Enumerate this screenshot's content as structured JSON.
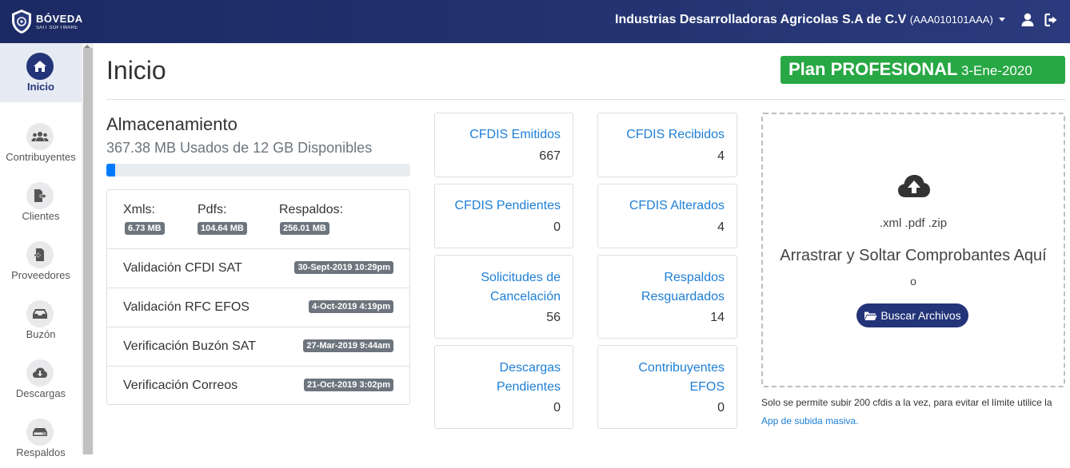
{
  "navbar": {
    "brand_name": "BÓVEDA",
    "brand_sub": "SAIT SOFTWARE",
    "company_name": "Industrias Desarrolladoras Agricolas S.A de C.V",
    "company_rfc": "(AAA010101AAA)",
    "icons": [
      "user-icon",
      "logout-icon",
      "caret-down-icon"
    ]
  },
  "sidebar": {
    "items": [
      {
        "label": "Inicio",
        "icon": "home-icon",
        "active": true
      },
      {
        "label": "Contribuyentes",
        "icon": "users-icon"
      },
      {
        "label": "Clientes",
        "icon": "file-export-icon"
      },
      {
        "label": "Proveedores",
        "icon": "file-import-icon"
      },
      {
        "label": "Buzón",
        "icon": "inbox-icon"
      },
      {
        "label": "Descargas",
        "icon": "download-icon"
      },
      {
        "label": "Respaldos",
        "icon": "hdd-icon"
      }
    ]
  },
  "header": {
    "title": "Inicio",
    "plan": "Plan PROFESIONAL",
    "plan_date": "3-Ene-2020"
  },
  "storage": {
    "title": "Almacenamiento",
    "subtitle": "367.38 MB Usados de 12 GB Disponibles",
    "used_fraction": 0.03,
    "stats": [
      {
        "label": "Xmls:",
        "value": "6.73 MB"
      },
      {
        "label": "Pdfs:",
        "value": "104.64 MB"
      },
      {
        "label": "Respaldos:",
        "value": "256.01 MB"
      }
    ],
    "rows": [
      {
        "label": "Validación CFDI SAT",
        "date": "30-Sept-2019 10:29pm"
      },
      {
        "label": "Validación RFC EFOS",
        "date": "4-Oct-2019 4:19pm"
      },
      {
        "label": "Verificación Buzón SAT",
        "date": "27-Mar-2019 9:44am"
      },
      {
        "label": "Verificación Correos",
        "date": "21-Oct-2019 3:02pm"
      }
    ]
  },
  "cards": [
    {
      "line1": "CFDIS Emitidos",
      "line2": "",
      "value": "667"
    },
    {
      "line1": "CFDIS Recibidos",
      "line2": "",
      "value": "4"
    },
    {
      "line1": "CFDIS Pendientes",
      "line2": "",
      "value": "0"
    },
    {
      "line1": "CFDIS Alterados",
      "line2": "",
      "value": "4"
    },
    {
      "line1": "Solicitudes de",
      "line2": "Cancelación",
      "value": "56"
    },
    {
      "line1": "Respaldos",
      "line2": "Resguardados",
      "value": "14"
    },
    {
      "line1": "Descargas",
      "line2": "Pendientes",
      "value": "0"
    },
    {
      "line1": "Contribuyentes",
      "line2": "EFOS",
      "value": "0"
    }
  ],
  "upload": {
    "extensions": ".xml .pdf .zip",
    "drop_text": "Arrastrar y Soltar Comprobantes Aquí",
    "or_text": "o",
    "button_label": "Buscar Archivos",
    "note": "Solo se permite subir 200 cfdis a la vez, para evitar el límite utilice la",
    "note_link": "App de subida masiva."
  },
  "colors": {
    "navbar": "#1b2a63",
    "accent": "#233478",
    "plan_green": "#28a745",
    "link_blue": "#1e7fd6",
    "badge_gray": "#6c757d",
    "progress_blue": "#007bff"
  }
}
